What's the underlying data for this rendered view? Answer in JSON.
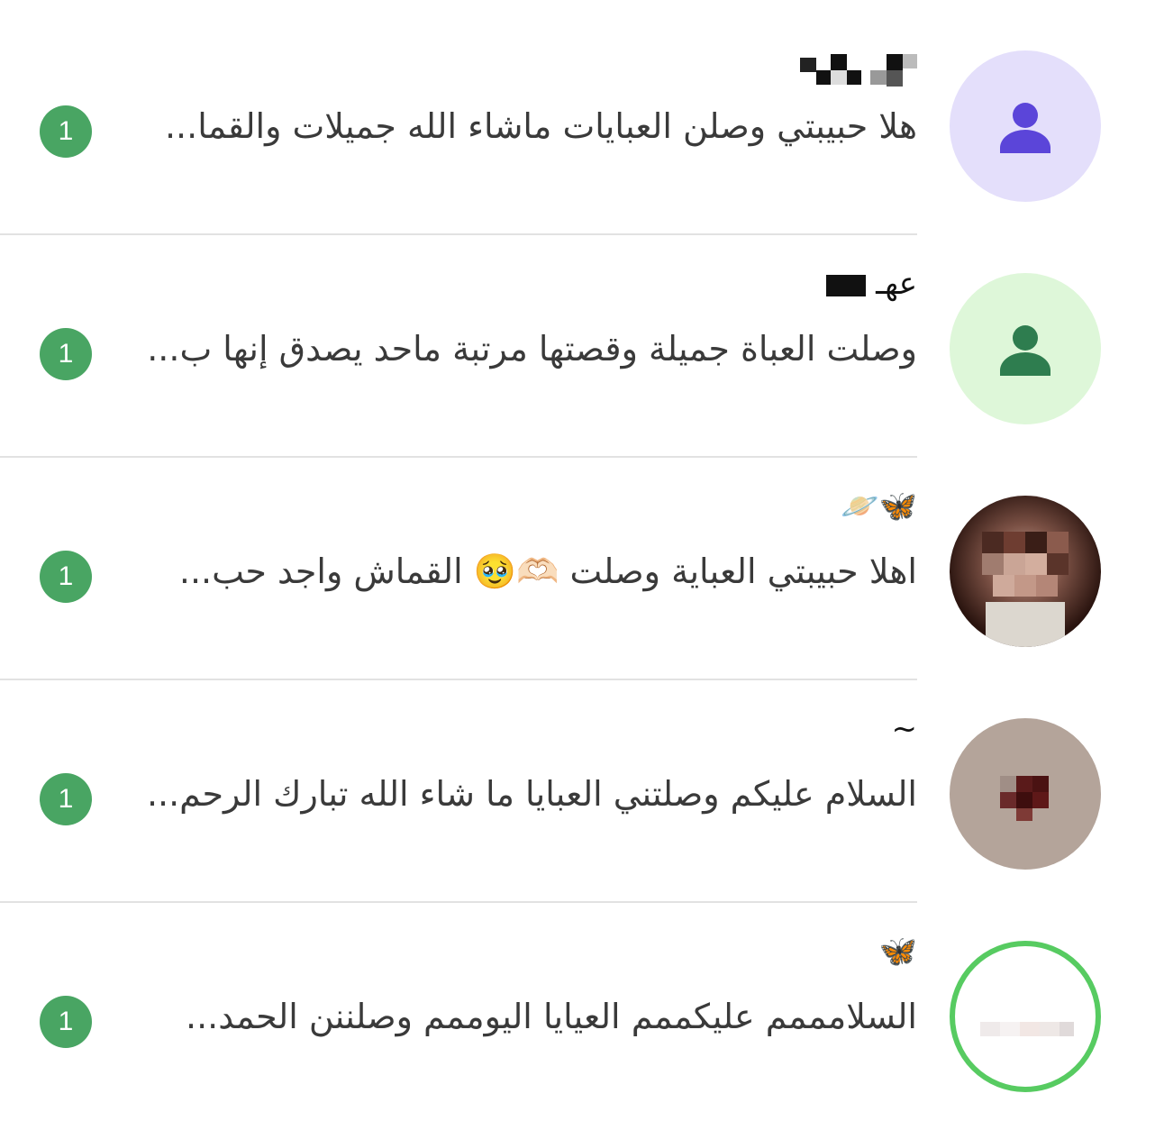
{
  "chats": [
    {
      "name": "",
      "name_style": "pixelated",
      "message": "هلا حبيبتي  وصلن العبايات ماشاء الله جميلات والقما...",
      "unread": "1",
      "avatar": {
        "icon": "person-icon",
        "bg": "#e4dffb",
        "fg": "#5b45d9"
      }
    },
    {
      "name": "عهـ",
      "name_style": "partially-pixelated",
      "message": "وصلت العباة جميلة وقصتها مرتبة ماحد يصدق إنها ب...",
      "unread": "1",
      "avatar": {
        "icon": "person-icon",
        "bg": "#def7d9",
        "fg": "#2e7d4f"
      }
    },
    {
      "name": "🦋🪐",
      "message": "اهلا حبيبتي  العباية وصلت 🫶🏻🥹 القماش واجد حب...",
      "unread": "1",
      "avatar": {
        "icon": "profile-photo-blurred"
      }
    },
    {
      "name": "~",
      "message": "السلام عليكم  وصلتني العبايا ما شاء الله تبارك الرحم...",
      "unread": "1",
      "avatar": {
        "icon": "profile-photo-blurred"
      }
    },
    {
      "name": "🦋",
      "message": "السلامممم عليكممم العيايا اليوممم وصلننن الحمد...",
      "unread": "1",
      "avatar": {
        "icon": "profile-photo-blurred",
        "ring": "#57cb61"
      }
    }
  ],
  "colors": {
    "badge": "#49a563",
    "divider": "#e2e2e2",
    "message_text": "#3a3a3a"
  }
}
